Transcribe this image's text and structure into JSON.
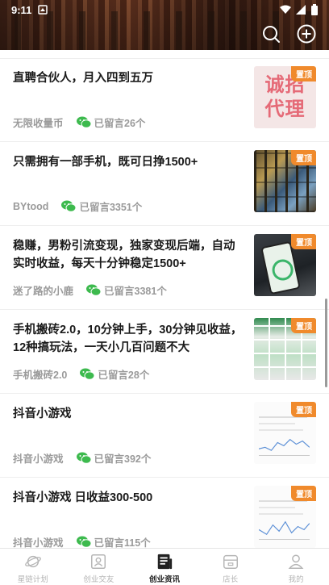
{
  "status_bar": {
    "time": "9:11"
  },
  "header": {
    "search_icon": "search-icon",
    "add_icon": "add-circle-icon"
  },
  "feed": {
    "items": [
      {
        "title": "直聘合伙人，月入四到五万",
        "source": "无限收量币",
        "comments": "已留言26个",
        "badge": "置顶",
        "thumb_text_1": "诚招",
        "thumb_text_2": "代理"
      },
      {
        "title": "只需拥有一部手机，既可日挣1500+",
        "source": "BYtood",
        "comments": "已留言3351个",
        "badge": "置顶"
      },
      {
        "title": "稳赚，男粉引流变现，独家变现后端，自动实时收益，每天十分钟稳定1500+",
        "source": "迷了路的小鹿",
        "comments": "已留言3381个",
        "badge": "置顶"
      },
      {
        "title": "手机搬砖2.0，10分钟上手，30分钟见收益，12种搞玩法，一天小几百问题不大",
        "source": "手机搬砖2.0",
        "comments": "已留言28个",
        "badge": "置顶"
      },
      {
        "title": "抖音小游戏",
        "source": "抖音小游戏",
        "comments": "已留言392个",
        "badge": "置顶"
      },
      {
        "title": "抖音小游戏 日收益300-500",
        "source": "抖音小游戏",
        "comments": "已留言115个",
        "badge": "置顶"
      }
    ]
  },
  "bottom_nav": {
    "items": [
      {
        "label": "星链计划",
        "icon": "planet-icon"
      },
      {
        "label": "创业交友",
        "icon": "contact-card-icon"
      },
      {
        "label": "创业资讯",
        "icon": "news-icon"
      },
      {
        "label": "店长",
        "icon": "shop-icon"
      },
      {
        "label": "我的",
        "icon": "profile-icon"
      }
    ],
    "active_index": 2
  },
  "colors": {
    "badge": "#f08a2c",
    "wechat_green": "#3dba4e",
    "active_nav": "#222222",
    "inactive_nav": "#b5b5b5"
  }
}
